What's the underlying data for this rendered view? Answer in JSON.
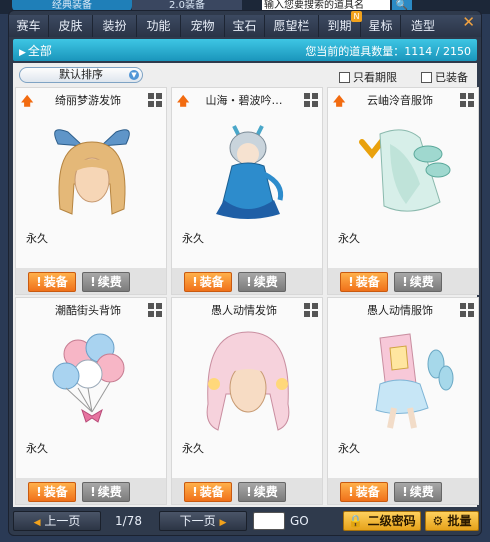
{
  "top": {
    "tab1": "经典装备",
    "tab2": "2.0装备",
    "search_placeholder": "输入您要搜索的道具名",
    "search_icon": "search-icon"
  },
  "menu": {
    "items": [
      "赛车",
      "皮肤",
      "装扮",
      "功能",
      "宠物",
      "宝石",
      "愿望栏",
      "到期",
      "星标",
      "造型"
    ],
    "new_badge": "N",
    "close": "✕"
  },
  "filter": {
    "category": "全部",
    "count_label": "您当前的道具数量：1114 / 2150"
  },
  "controls": {
    "sort": "默认排序",
    "only_expiring": "只看期限",
    "equipped": "已装备"
  },
  "items": [
    {
      "name": "绮丽梦游发饰",
      "duration": "永久",
      "upgrade": true,
      "equip": "装备",
      "renew": "续费",
      "exclaim": "!"
    },
    {
      "name": "山海・碧波吟…",
      "duration": "永久",
      "upgrade": true,
      "equip": "装备",
      "renew": "续费",
      "exclaim": "!"
    },
    {
      "name": "云岫泠音服饰",
      "duration": "永久",
      "upgrade": true,
      "equip": "装备",
      "renew": "续费",
      "exclaim": "!"
    },
    {
      "name": "潮酷街头背饰",
      "duration": "永久",
      "upgrade": false,
      "equip": "装备",
      "renew": "续费",
      "exclaim": "!"
    },
    {
      "name": "愚人动情发饰",
      "duration": "永久",
      "upgrade": false,
      "equip": "装备",
      "renew": "续费",
      "exclaim": "!"
    },
    {
      "name": "愚人动情服饰",
      "duration": "永久",
      "upgrade": false,
      "equip": "装备",
      "renew": "续费",
      "exclaim": "!"
    }
  ],
  "footer": {
    "prev": "上一页",
    "page": "1/78",
    "next": "下一页",
    "go": "GO",
    "password": "二级密码",
    "batch": "批量"
  },
  "colors": {
    "equip": "#f0711a",
    "accent": "#1a95bb",
    "gold": "#e6a21a"
  }
}
